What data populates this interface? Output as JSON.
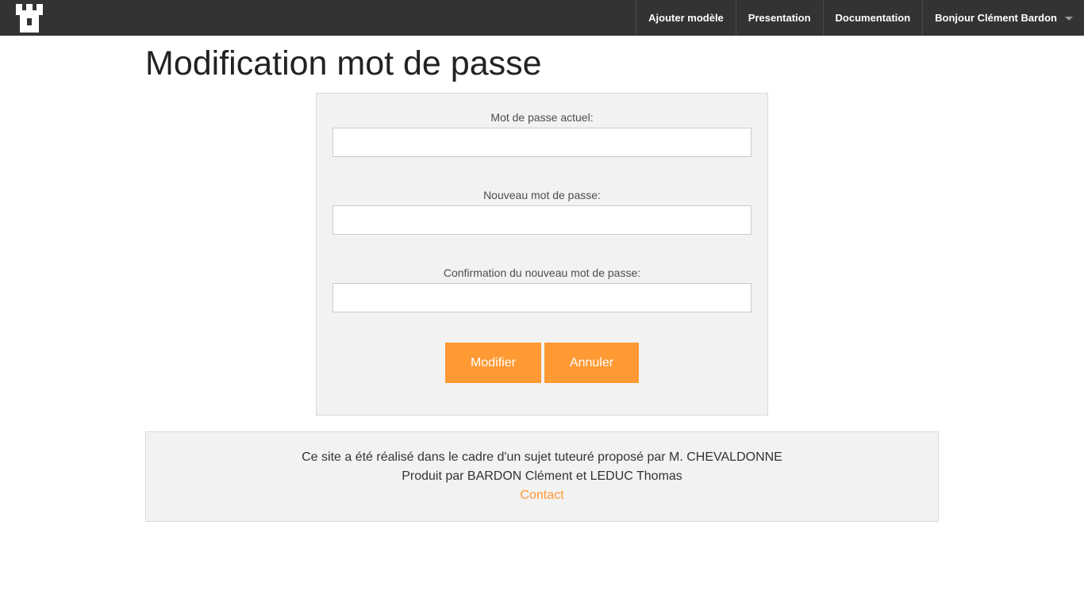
{
  "navbar": {
    "logo_icon": "castle-tower-icon",
    "items": [
      {
        "label": "Ajouter modèle"
      },
      {
        "label": "Presentation"
      },
      {
        "label": "Documentation"
      },
      {
        "label": "Bonjour Clément Bardon",
        "icon": "chevron-down-icon"
      }
    ]
  },
  "page": {
    "title": "Modification mot de passe"
  },
  "form": {
    "current_password": {
      "label": "Mot de passe actuel:",
      "value": ""
    },
    "new_password": {
      "label": "Nouveau mot de passe:",
      "value": ""
    },
    "confirm_password": {
      "label": "Confirmation du nouveau mot de passe:",
      "value": ""
    },
    "submit_label": "Modifier",
    "cancel_label": "Annuler"
  },
  "footer": {
    "line1": "Ce site a été réalisé dans le cadre d'un sujet tuteuré proposé par M. CHEVALDONNE",
    "line2": "Produit par BARDON Clément et LEDUC Thomas",
    "contact_label": "Contact"
  },
  "colors": {
    "navbar_bg": "#333333",
    "accent": "#ff9933",
    "panel_bg": "#f2f2f2"
  }
}
